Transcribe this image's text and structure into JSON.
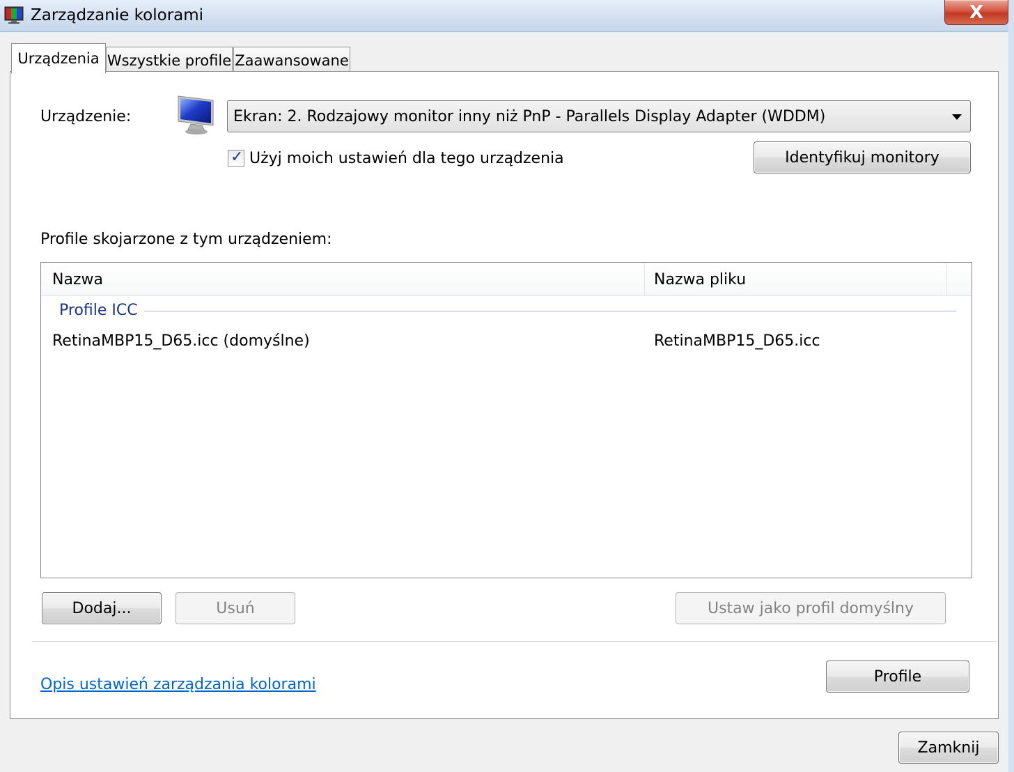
{
  "window": {
    "title": "Zarządzanie kolorami",
    "close_label": "X"
  },
  "tabs": [
    {
      "label": "Urządzenia",
      "active": true
    },
    {
      "label": "Wszystkie profile",
      "active": false
    },
    {
      "label": "Zaawansowane",
      "active": false
    }
  ],
  "device": {
    "label": "Urządzenie:",
    "selected": "Ekran: 2. Rodzajowy monitor inny niż PnP - Parallels Display Adapter (WDDM)",
    "use_my_settings_label": "Użyj moich ustawień dla tego urządzenia",
    "use_my_settings_checked": true,
    "identify_button": "Identyfikuj monitory"
  },
  "profiles": {
    "section_label": "Profile skojarzone z tym urządzeniem:",
    "columns": [
      "Nazwa",
      "Nazwa pliku"
    ],
    "group": "Profile ICC",
    "rows": [
      {
        "name": "RetinaMBP15_D65.icc (domyślne)",
        "file": "RetinaMBP15_D65.icc"
      }
    ]
  },
  "buttons": {
    "add": "Dodaj...",
    "remove": "Usuń",
    "set_default": "Ustaw jako profil domyślny",
    "profiles": "Profile",
    "close": "Zamknij"
  },
  "link": "Opis ustawień zarządzania kolorami",
  "colors": {
    "link": "#0066cc",
    "group_header": "#1e3287",
    "close_button": "#c13a22"
  }
}
